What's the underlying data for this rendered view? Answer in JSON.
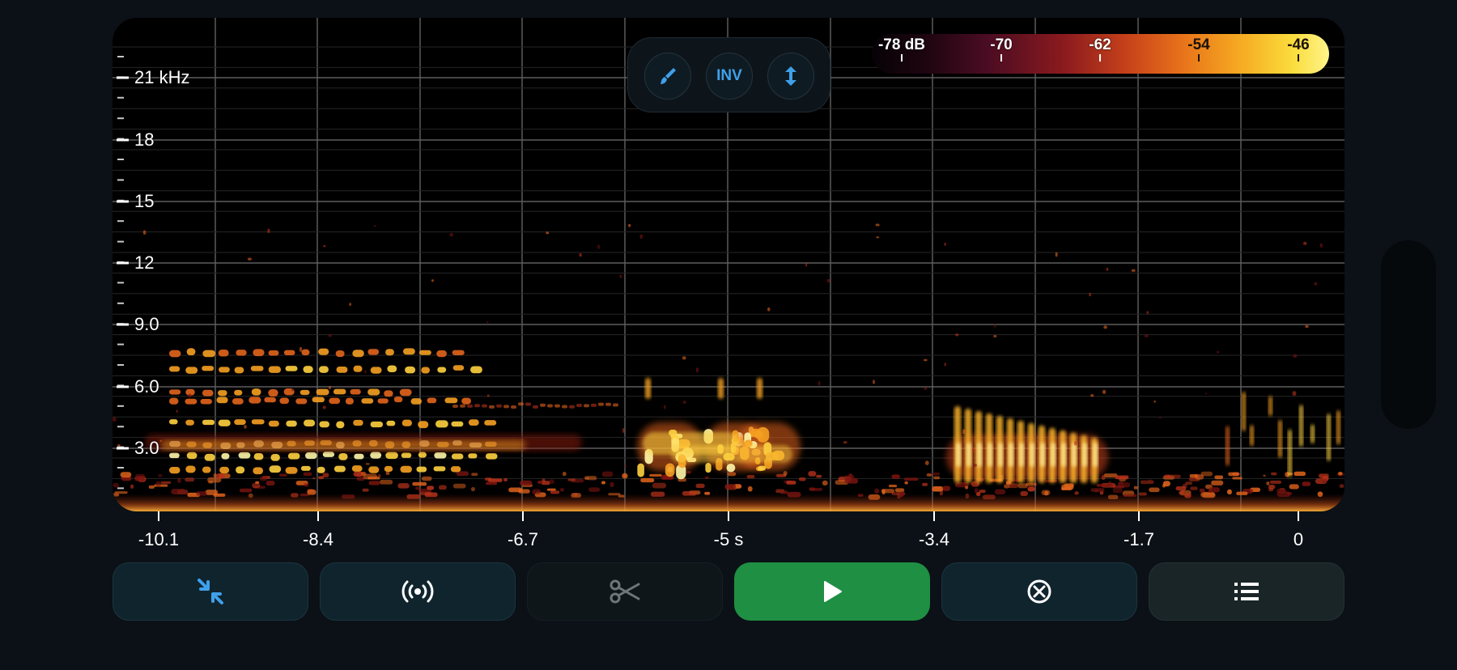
{
  "spectrogram": {
    "freq_labels": [
      "21 kHz",
      "18",
      "15",
      "12",
      "9.0",
      "6.0",
      "3.0"
    ],
    "time_labels": [
      "-10.1",
      "-8.4",
      "-6.7",
      "-5 s",
      "-3.4",
      "-1.7",
      "0"
    ]
  },
  "overlay_tools": {
    "brush_icon": "brush-icon",
    "invert_label": "INV",
    "scale_icon": "vertical-arrows-icon"
  },
  "db_legend": {
    "labels": [
      "-78 dB",
      "-70",
      "-62",
      "-54",
      "-46"
    ],
    "colors": [
      "#060206",
      "#4a0c22",
      "#c7421a",
      "#f5a821",
      "#fff48a"
    ]
  },
  "toolbar": {
    "compress_icon": "compress-arrows-icon",
    "broadcast_icon": "broadcast-icon",
    "cut_icon": "scissors-icon",
    "play_icon": "play-icon",
    "clear_icon": "clear-icon",
    "list_icon": "list-icon"
  },
  "colors": {
    "background": "#0b1116",
    "accent_blue": "#3fa0ea",
    "play_green": "#1f8f43"
  }
}
